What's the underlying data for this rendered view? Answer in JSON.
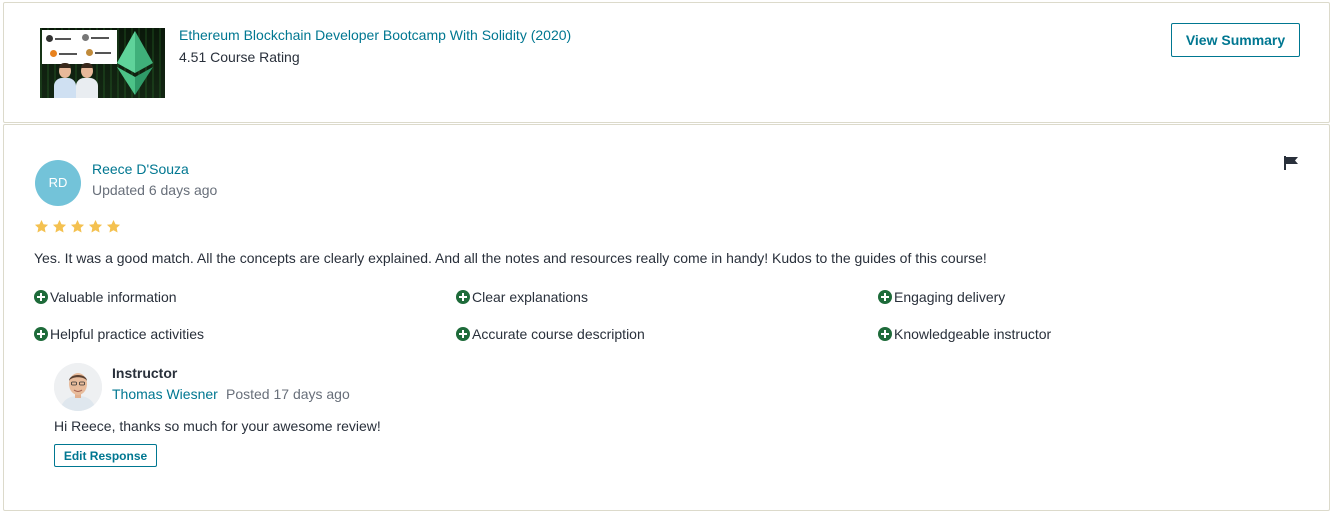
{
  "course": {
    "title": "Ethereum Blockchain Developer Bootcamp With Solidity (2020)",
    "rating_text": "4.51 Course Rating",
    "view_summary_label": "View Summary",
    "thumbnail_icon": "ethereum-logo-icon"
  },
  "review": {
    "avatar_initials": "RD",
    "avatar_color": "#73c3d9",
    "reviewer_name": "Reece D'Souza",
    "updated": "Updated 6 days ago",
    "rating_stars": 5,
    "star_color": "#f4c150",
    "flag_icon": "flag-icon",
    "text": "Yes. It was a good match. All the concepts are clearly explained. And all the notes and resources really come in handy! Kudos to the guides of this course!",
    "tags": [
      "Valuable information",
      "Clear explanations",
      "Engaging delivery",
      "Helpful practice activities",
      "Accurate course description",
      "Knowledgeable instructor"
    ],
    "tag_icon": "plus-circle-icon",
    "tag_icon_color": "#1e6b3a"
  },
  "response": {
    "label": "Instructor",
    "instructor_name": "Thomas Wiesner",
    "posted": "Posted 17 days ago",
    "text": "Hi Reece, thanks so much for your awesome review!",
    "edit_label": "Edit Response"
  },
  "colors": {
    "link": "#007791",
    "text": "#29303b",
    "muted": "#686f7a",
    "border": "#dcdacb"
  }
}
